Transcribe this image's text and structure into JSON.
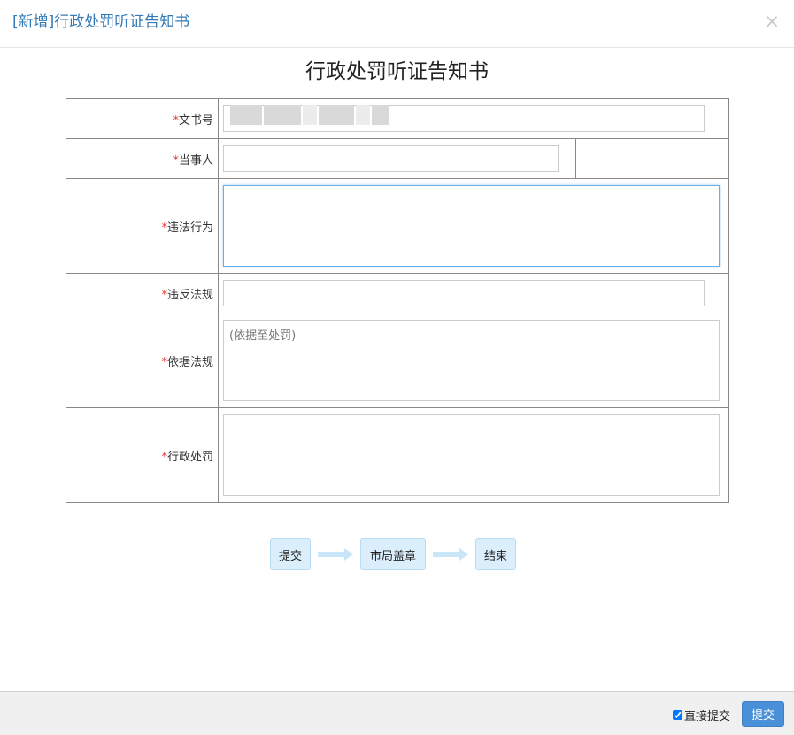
{
  "dialog": {
    "title": "[新增]行政处罚听证告知书",
    "close_glyph": "×"
  },
  "document": {
    "title": "行政处罚听证告知书"
  },
  "form": {
    "required_mark": "*",
    "fields": [
      {
        "label": "文书号",
        "value": "",
        "placeholder": ""
      },
      {
        "label": "当事人",
        "value": "",
        "placeholder": ""
      },
      {
        "label": "违法行为",
        "value": "",
        "placeholder": ""
      },
      {
        "label": "违反法规",
        "value": "",
        "placeholder": ""
      },
      {
        "label": "依据法规",
        "value": "",
        "placeholder": "(依据至处罚)"
      },
      {
        "label": "行政处罚",
        "value": "",
        "placeholder": ""
      }
    ]
  },
  "workflow": {
    "steps": [
      "提交",
      "市局盖章",
      "结束"
    ]
  },
  "footer": {
    "direct_submit_label": "直接提交",
    "direct_submit_checked": true,
    "submit_label": "提交"
  },
  "colors": {
    "title_blue": "#337ab7",
    "required_red": "#e53935",
    "step_bg": "#dbeefb",
    "arrow": "#c9e6f8",
    "button_blue": "#4a90d9"
  }
}
